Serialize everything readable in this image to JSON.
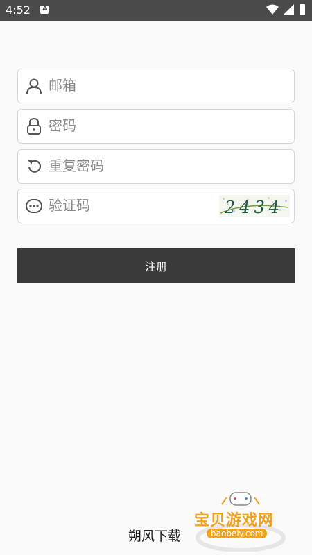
{
  "status_bar": {
    "time": "4:52",
    "badge_letter": "A"
  },
  "form": {
    "email_placeholder": "邮箱",
    "password_placeholder": "密码",
    "confirm_placeholder": "重复密码",
    "captcha_placeholder": "验证码",
    "captcha_code": "2434",
    "submit_label": "注册"
  },
  "footer": {
    "text": "朔风下载"
  },
  "watermark": {
    "title": "宝贝游戏网",
    "url": "baobeiy.com"
  },
  "colors": {
    "button": "#3a3a3a",
    "field_border": "#d5d6e0",
    "status_bar": "#4a4a4a",
    "watermark": "#f0a11d"
  },
  "icons": [
    "user-icon",
    "lock-icon",
    "refresh-icon",
    "chat-dots-icon"
  ]
}
